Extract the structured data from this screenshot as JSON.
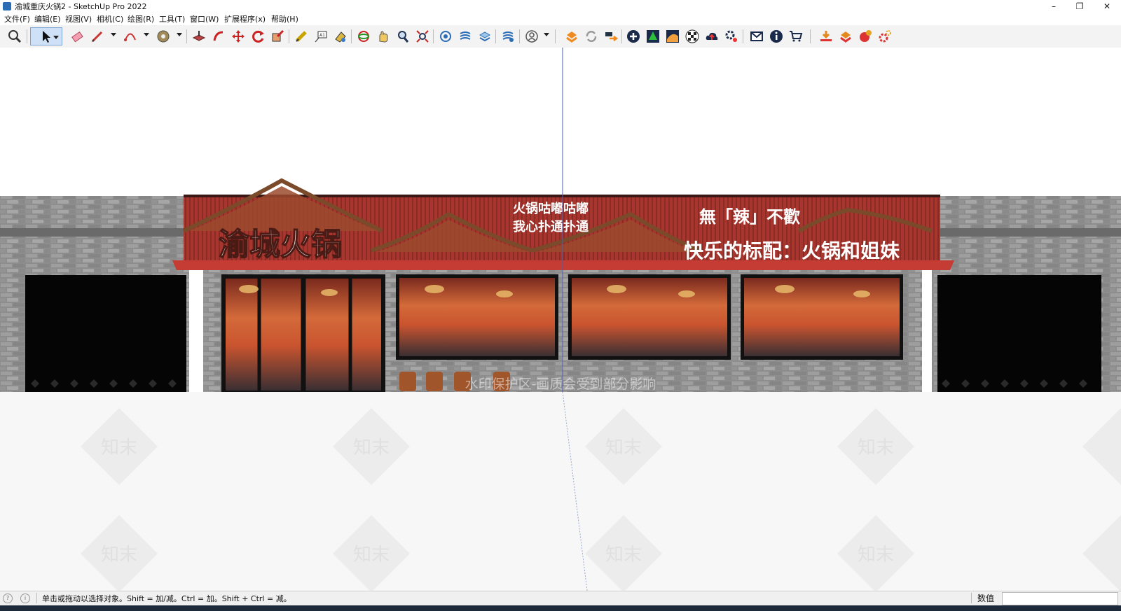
{
  "window": {
    "title": "渝城重庆火锅2 - SketchUp Pro 2022",
    "minimize": "–",
    "restore": "❐",
    "close": "✕"
  },
  "menu": {
    "items": [
      "文件(F)",
      "编辑(E)",
      "视图(V)",
      "相机(C)",
      "绘图(R)",
      "工具(T)",
      "窗口(W)",
      "扩展程序(x)",
      "帮助(H)"
    ]
  },
  "toolbar": {
    "icons": [
      "zoom-icon",
      "select-icon",
      "eraser-icon",
      "pencil-icon",
      "arc-icon",
      "tape-icon",
      "pushpull-icon",
      "followme-icon",
      "move-icon",
      "rotate-icon",
      "scale-icon",
      "measure-icon",
      "text-icon",
      "paint-icon",
      "orbit-icon",
      "pan-icon",
      "zoom-tool-icon",
      "zoom-extents-icon",
      "outliner-icon",
      "layers-icon",
      "styles-icon",
      "components-icon",
      "user-icon",
      "warehouse-icon",
      "sync-icon",
      "send-icon",
      "add-location-icon",
      "tree-icon",
      "sandbox-icon",
      "checker-icon",
      "cloud-upload-icon",
      "settings-icon",
      "mail-icon",
      "info-icon",
      "cart-icon",
      "import-icon",
      "export-icon",
      "plugin-icon",
      "gear-red-icon"
    ]
  },
  "scene": {
    "brand_sign": "渝城火锅",
    "slogan_line1": "火锅咕嘟咕嘟",
    "slogan_line2": "我心扑通扑通",
    "headline1": "無「辣」不歡",
    "headline2": "快乐的标配：火锅和姐妹",
    "overlay_text": "水印保护区-画质会受到部分影响",
    "watermark_text": "知末",
    "colors": {
      "roof_red": "#b53a34",
      "brick": "#8a8a8a",
      "window_interior": "#c8552f"
    }
  },
  "status": {
    "message": "单击或拖动以选择对象。Shift = 加/减。Ctrl = 加。Shift + Ctrl = 减。",
    "measure_label": "数值",
    "measure_value": ""
  }
}
